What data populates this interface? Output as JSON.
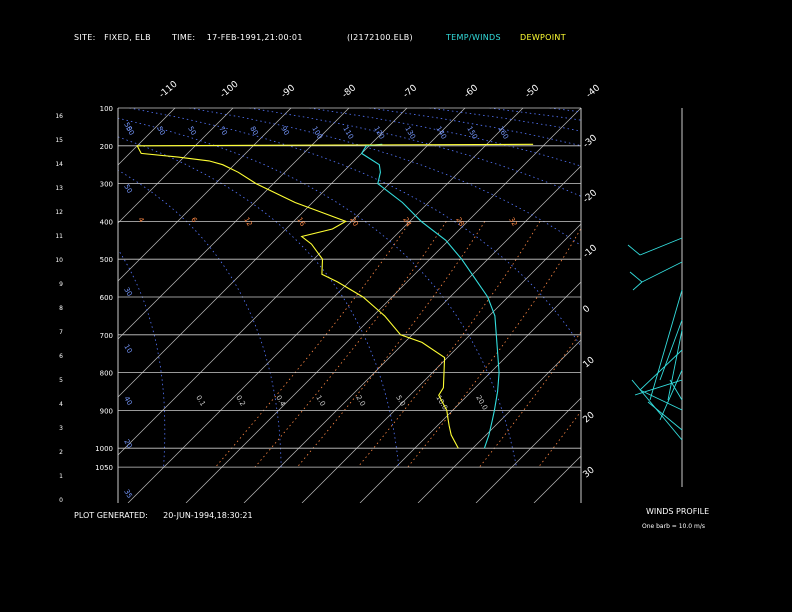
{
  "header": {
    "site_label": "SITE:",
    "site_value": "FIXED, ELB",
    "time_label": "TIME:",
    "time_value": "17-FEB-1991,21:00:01",
    "file": "(I2172100.ELB)",
    "temp_label": "TEMP/WINDS",
    "dew_label": "DEWPOINT"
  },
  "footer": {
    "plot_label": "PLOT GENERATED:",
    "plot_value": "20-JUN-1994,18:30:21",
    "winds_title": "WINDS PROFILE",
    "barb_note": "One barb = 10.0 m/s"
  },
  "colors": {
    "temp": "#33dddd",
    "dewpoint": "#ffff33",
    "mixing": "#ff8844",
    "isotherm_lab": "#7799ff",
    "grid": "#cccccc"
  },
  "chart_data": {
    "type": "line",
    "title": "",
    "pressure_levels": [
      100,
      200,
      300,
      400,
      500,
      600,
      700,
      800,
      900,
      1000,
      1050
    ],
    "height_km_ticks": [
      0,
      1,
      2,
      3,
      4,
      5,
      6,
      7,
      8,
      9,
      10,
      11,
      12,
      13,
      14,
      15,
      16
    ],
    "isotherm_top_labels": [
      "-110",
      "-100",
      "-90",
      "-80",
      "-70",
      "-60",
      "-50",
      "-40"
    ],
    "isotherm_right_labels": [
      "-30",
      "-20",
      "-10",
      "0",
      "10",
      "20",
      "30"
    ],
    "upper_dotted_labels": [
      "50",
      "50",
      "50",
      "70",
      "80",
      "90",
      "100",
      "110",
      "120",
      "130",
      "140",
      "150",
      "160"
    ],
    "mixing_ratio_upper_labels": [
      "4",
      "6",
      "12",
      "16",
      "20",
      "24",
      "28",
      "32"
    ],
    "mixing_ratio_lower_labels": [
      "0.1",
      "0.2",
      "0.4",
      "1.0",
      "2.0",
      "5.0",
      "10.0",
      "20.0"
    ],
    "left_dotted_labels": [
      "50",
      "50",
      "30",
      "10",
      "40",
      "20",
      "35",
      "35",
      "35"
    ],
    "series": [
      {
        "name": "TEMP/WINDS",
        "points": [
          [
            1000,
            2.0
          ],
          [
            965,
            0.5
          ],
          [
            925,
            -1.5
          ],
          [
            900,
            -2.8
          ],
          [
            850,
            -5.5
          ],
          [
            800,
            -8.5
          ],
          [
            750,
            -12.0
          ],
          [
            700,
            -15.5
          ],
          [
            650,
            -19.0
          ],
          [
            600,
            -23.5
          ],
          [
            550,
            -29.0
          ],
          [
            500,
            -34.5
          ],
          [
            450,
            -40.5
          ],
          [
            400,
            -48.0
          ],
          [
            350,
            -54.5
          ],
          [
            300,
            -62.0
          ],
          [
            270,
            -63.5
          ],
          [
            250,
            -65.0
          ],
          [
            220,
            -70.0
          ],
          [
            200,
            -70.5
          ],
          [
            196,
            -68.0
          ]
        ]
      },
      {
        "name": "DEWPOINT",
        "points": [
          [
            1000,
            -2.5
          ],
          [
            965,
            -6.0
          ],
          [
            940,
            -8.0
          ],
          [
            920,
            -9.5
          ],
          [
            900,
            -11.0
          ],
          [
            860,
            -15.0
          ],
          [
            840,
            -15.5
          ],
          [
            800,
            -18.0
          ],
          [
            760,
            -20.5
          ],
          [
            720,
            -27.0
          ],
          [
            700,
            -32.0
          ],
          [
            650,
            -38.0
          ],
          [
            600,
            -45.0
          ],
          [
            560,
            -52.0
          ],
          [
            540,
            -56.0
          ],
          [
            500,
            -58.5
          ],
          [
            460,
            -63.0
          ],
          [
            440,
            -66.0
          ],
          [
            420,
            -62.0
          ],
          [
            400,
            -61.0
          ],
          [
            375,
            -67.0
          ],
          [
            350,
            -73.0
          ],
          [
            300,
            -83.0
          ],
          [
            270,
            -88.0
          ],
          [
            250,
            -92.0
          ],
          [
            240,
            -95.0
          ],
          [
            230,
            -101.0
          ],
          [
            220,
            -108.0
          ],
          [
            200,
            -110.0
          ],
          [
            196,
            -42.0
          ]
        ]
      }
    ]
  }
}
